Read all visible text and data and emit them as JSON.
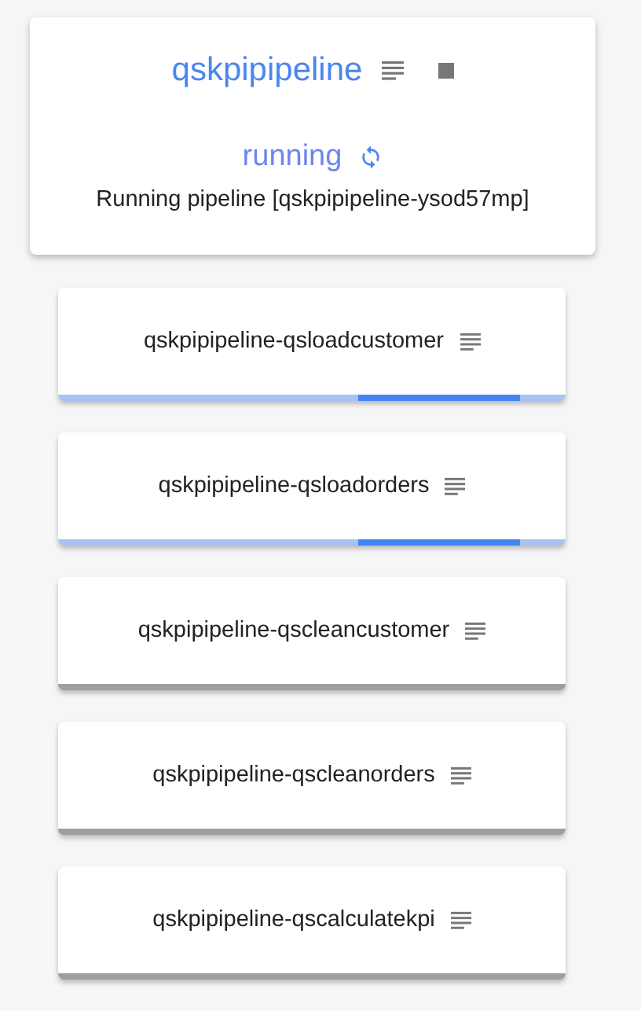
{
  "pipeline": {
    "name": "qskpipipeline",
    "status": "running",
    "message": "Running pipeline [qskpipipeline-ysod57mp]"
  },
  "steps": [
    {
      "name": "qskpipipeline-qsloadcustomer",
      "kind": "running"
    },
    {
      "name": "qskpipipeline-qsloadorders",
      "kind": "running"
    },
    {
      "name": "qskpipipeline-qscleancustomer",
      "kind": "pending"
    },
    {
      "name": "qskpipipeline-qscleanorders",
      "kind": "pending"
    },
    {
      "name": "qskpipipeline-qscalculatekpi",
      "kind": "pending"
    }
  ]
}
